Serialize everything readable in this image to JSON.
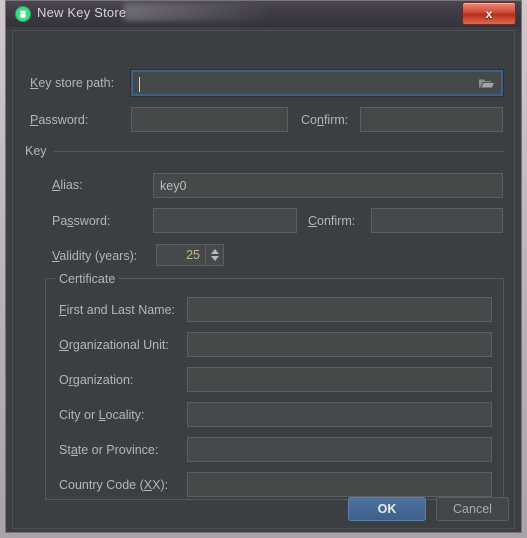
{
  "window": {
    "title": "New Key Store",
    "app_icon": "android-keystore-icon",
    "close_label": "x",
    "frame_color": "#c4bdc2",
    "content_bg": "#3c3f41"
  },
  "keystore_section": {
    "path_label": {
      "prefix": "",
      "mnemonic": "K",
      "suffix": "ey store path:"
    },
    "path_value": "",
    "path_focused": true,
    "browse_icon": "folder-icon",
    "password_label": {
      "prefix": "",
      "mnemonic": "P",
      "suffix": "assword:"
    },
    "password_value": "",
    "confirm_label": {
      "prefix": "Co",
      "mnemonic": "n",
      "suffix": "firm:"
    },
    "confirm_value": ""
  },
  "key_section": {
    "title": "Key",
    "alias_label": {
      "prefix": "",
      "mnemonic": "A",
      "suffix": "lias:"
    },
    "alias_value": "key0",
    "password_label": {
      "prefix": "Pa",
      "mnemonic": "s",
      "suffix": "sword:"
    },
    "password_value": "",
    "confirm_label": {
      "prefix": "",
      "mnemonic": "C",
      "suffix": "onfirm:"
    },
    "confirm_value": "",
    "validity_label": {
      "prefix": "",
      "mnemonic": "V",
      "suffix": "alidity (years):"
    },
    "validity_value": "25"
  },
  "certificate_section": {
    "title": "Certificate",
    "fields": [
      {
        "label_prefix": "",
        "label_mnemonic": "F",
        "label_suffix": "irst and Last Name:",
        "value": ""
      },
      {
        "label_prefix": "",
        "label_mnemonic": "O",
        "label_suffix": "rganizational Unit:",
        "value": ""
      },
      {
        "label_prefix": "O",
        "label_mnemonic": "r",
        "label_suffix": "ganization:",
        "value": ""
      },
      {
        "label_prefix": "City or ",
        "label_mnemonic": "L",
        "label_suffix": "ocality:",
        "value": ""
      },
      {
        "label_prefix": "St",
        "label_mnemonic": "a",
        "label_suffix": "te or Province:",
        "value": ""
      },
      {
        "label_prefix": "Country Code (",
        "label_mnemonic": "X",
        "label_suffix": "X):",
        "value": ""
      }
    ]
  },
  "footer": {
    "ok_label": "OK",
    "cancel_label": "Cancel",
    "ok_color": "#43699a"
  }
}
